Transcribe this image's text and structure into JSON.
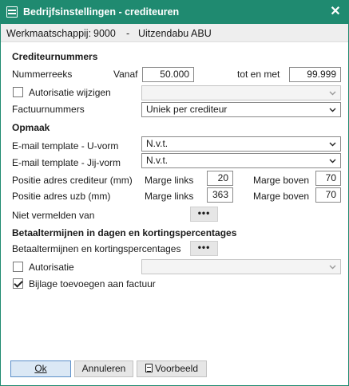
{
  "window": {
    "title": "Bedrijfsinstellingen - crediteuren",
    "close_symbol": "✕"
  },
  "company": {
    "label": "Werkmaatschappij:",
    "code": "9000",
    "separator": "-",
    "name": "Uitzendabu ABU"
  },
  "crediteurnummers": {
    "heading": "Crediteurnummers",
    "nummerreeks_label": "Nummerreeks",
    "vanaf_label": "Vanaf",
    "vanaf_value": "50.000",
    "tot_label": "tot en met",
    "tot_value": "99.999",
    "autorisatie_label": "Autorisatie wijzigen",
    "autorisatie_checked": false,
    "autorisatie_value": "",
    "factuurnummers_label": "Factuurnummers",
    "factuurnummers_value": "Uniek per crediteur"
  },
  "opmaak": {
    "heading": "Opmaak",
    "email_u_label": "E-mail template - U-vorm",
    "email_u_value": "N.v.t.",
    "email_jij_label": "E-mail template - Jij-vorm",
    "email_jij_value": "N.v.t.",
    "positie_crediteur_label": "Positie adres crediteur (mm)",
    "positie_uzb_label": "Positie adres uzb (mm)",
    "marge_links_label": "Marge links",
    "marge_boven_label": "Marge boven",
    "crediteur_marge_links": "20",
    "crediteur_marge_boven": "70",
    "uzb_marge_links": "363",
    "uzb_marge_boven": "70",
    "niet_vermelden_label": "Niet vermelden van",
    "dots_label": "•••"
  },
  "betaaltermijnen": {
    "heading": "Betaaltermijnen in dagen en kortingspercentages",
    "label": "Betaaltermijnen en kortingspercentages",
    "dots_label": "•••",
    "autorisatie_label": "Autorisatie",
    "autorisatie_checked": false,
    "autorisatie_value": "",
    "bijlage_label": "Bijlage toevoegen aan factuur",
    "bijlage_checked": true
  },
  "footer": {
    "ok_label": "Ok",
    "annuleren_label": "Annuleren",
    "voorbeeld_label": "Voorbeeld"
  },
  "colors": {
    "titlebar": "#1f8a70",
    "company_bar": "#eeeeee",
    "primary_button": "#dbe8f5"
  }
}
